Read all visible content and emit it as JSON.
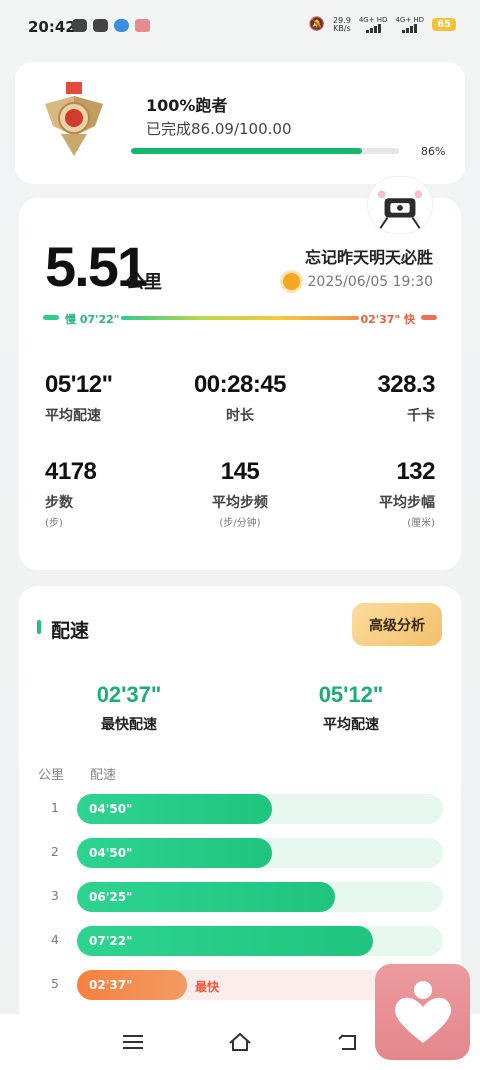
{
  "status_bar": {
    "time": "20:42",
    "net_speed": "29.9",
    "net_speed_unit": "KB/s",
    "sim1": "4G+ HD",
    "sim2": "4G+ HD",
    "battery": "65"
  },
  "badge": {
    "title": "100%跑者",
    "progress_text": "已完成86.09/100.00",
    "percent_label": "86%",
    "percent_value": 86.09
  },
  "summary": {
    "distance": "5.51",
    "distance_unit": "公里",
    "motto": "忘记昨天明天必胜",
    "datetime": "2025/06/05 19:30",
    "slow_label": "慢 07'22\"",
    "fast_label": "02'37\" 快"
  },
  "stats": [
    {
      "value": "05'12\"",
      "label": "平均配速",
      "sub": ""
    },
    {
      "value": "00:28:45",
      "label": "时长",
      "sub": ""
    },
    {
      "value": "328.3",
      "label": "千卡",
      "sub": ""
    },
    {
      "value": "4178",
      "label": "步数",
      "sub": "(步)"
    },
    {
      "value": "145",
      "label": "平均步频",
      "sub": "(步/分钟)"
    },
    {
      "value": "132",
      "label": "平均步幅",
      "sub": "(厘米)"
    }
  ],
  "pace_section": {
    "title": "配速",
    "advanced_button": "高级分析",
    "fastest_value": "02'37\"",
    "fastest_label": "最快配速",
    "average_value": "05'12\"",
    "average_label": "平均配速",
    "col_km": "公里",
    "col_pace": "配速",
    "fastest_tag": "最快",
    "rows": [
      {
        "km": "1",
        "pace": "04'50\"",
        "seconds": 290
      },
      {
        "km": "2",
        "pace": "04'50\"",
        "seconds": 290
      },
      {
        "km": "3",
        "pace": "06'25\"",
        "seconds": 385
      },
      {
        "km": "4",
        "pace": "07'22\"",
        "seconds": 442
      },
      {
        "km": "5",
        "pace": "02'37\"",
        "seconds": 157
      }
    ]
  },
  "colors": {
    "accent_green": "#1fc27f",
    "fast_orange": "#f6813f",
    "gold": "#f2c06b"
  },
  "icons": {
    "nav_menu": "menu-icon",
    "nav_home": "home-icon",
    "nav_back": "back-icon",
    "fab": "heart-app-icon"
  }
}
